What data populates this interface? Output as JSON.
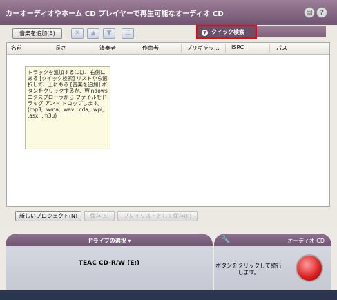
{
  "window": {
    "title": "カーオーディオやホーム CD プレイヤーで再生可能なオーディオ CD",
    "help_glyph": "?",
    "pin_glyph": "▤"
  },
  "toolbar": {
    "add_music_label": "音楽を追加(A)",
    "icon_buttons": [
      "remove-icon",
      "move-up-icon",
      "move-down-icon",
      "properties-icon"
    ],
    "quick_search_label": "クイック検索"
  },
  "list": {
    "columns": [
      "名前",
      "長さ",
      "演奏者",
      "作曲者",
      "プリギャッ...",
      "ISRC",
      "パス"
    ],
    "hint": "トラックを追加するには、右側にある [クイック検索] リストから選択して、上にある [音楽を追加] ボタンをクリックするか、Windows エクスプローラから ファイルをドラッグ アンド ドロップします。(mp3, .wma, .wav, .cda, .wpl, .asx, .m3u)"
  },
  "footer_buttons": {
    "new_project": "新しいプロジェクト(N)",
    "save": "保存(S)",
    "save_as_playlist": "プレイリストとして保存(P)"
  },
  "drive_panel": {
    "header": "ドライブの選択",
    "drive_name": "TEAC CD-R/W (E:)"
  },
  "burn_panel": {
    "header": "オーディオ CD",
    "instruction": "ボタンをクリックして続行します。"
  }
}
